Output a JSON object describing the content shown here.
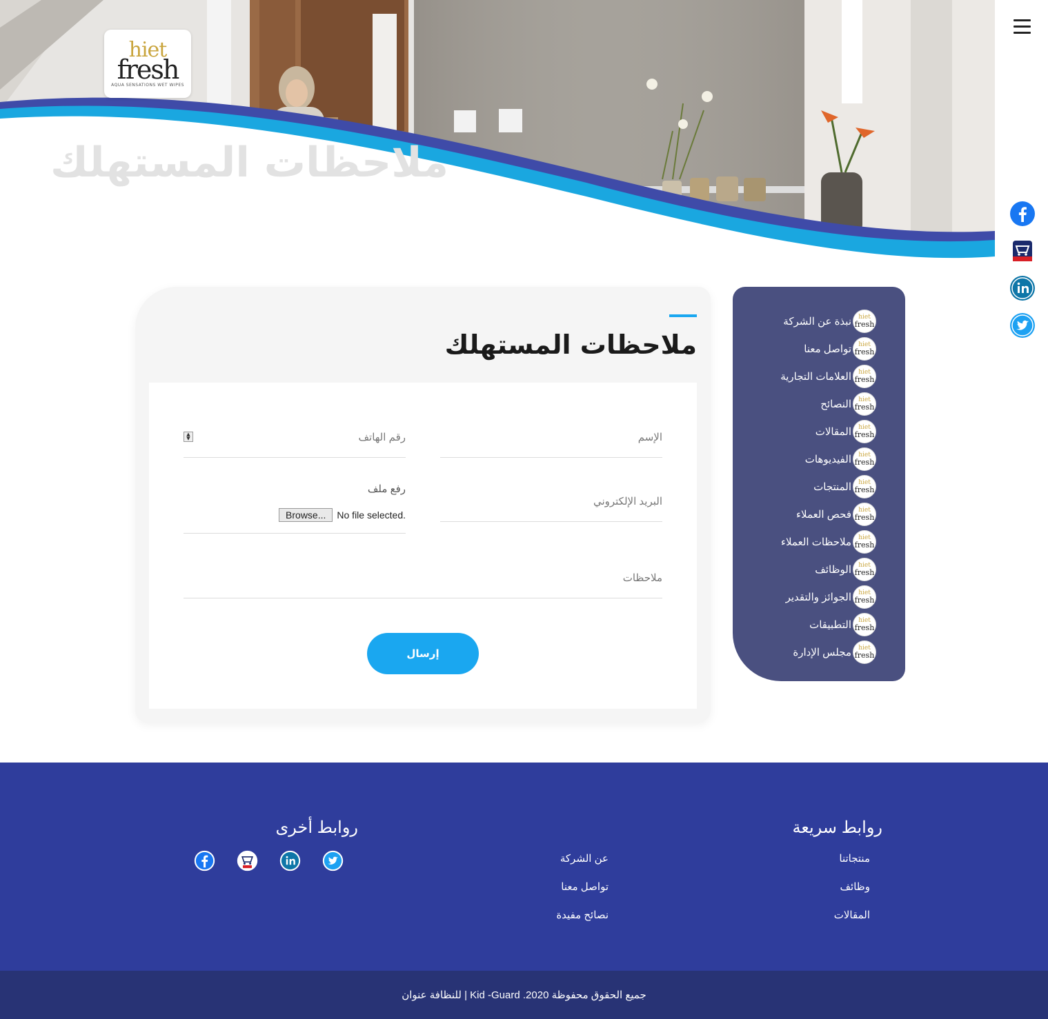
{
  "hero": {
    "title": "ملاحظات المستهلك",
    "logo": {
      "line1": "hiet",
      "line2": "fresh",
      "tagline": "AQUA SENSATIONS WET WIPES"
    }
  },
  "header": {
    "menu_icon": "hamburger-icon"
  },
  "side_social": [
    {
      "name": "facebook-icon",
      "color": "#1877f2"
    },
    {
      "name": "thelist-icon",
      "color": "#d81f26"
    },
    {
      "name": "linkedin-icon",
      "color": "#0e76a8"
    },
    {
      "name": "twitter-icon",
      "color": "#1da1f2"
    }
  ],
  "form": {
    "heading": "ملاحظات المستهلك",
    "name_placeholder": "الإسم",
    "phone_placeholder": "رقم الهاتف",
    "email_placeholder": "البريد الإلكتروني",
    "file_label": "رفع ملف",
    "file_button": "Browse...",
    "file_status": "No file selected.",
    "notes_placeholder": "ملاحظات",
    "submit_label": "إرسال"
  },
  "sidebar": {
    "items": [
      {
        "label": "نبذة عن الشركة"
      },
      {
        "label": "تواصل معنا"
      },
      {
        "label": "العلامات التجارية"
      },
      {
        "label": "النصائح"
      },
      {
        "label": "المقالات"
      },
      {
        "label": "الفيديوهات"
      },
      {
        "label": "المنتجات"
      },
      {
        "label": "فحص العملاء"
      },
      {
        "label": "ملاحظات العملاء"
      },
      {
        "label": "الوظائف"
      },
      {
        "label": "الجوائز والتقدير"
      },
      {
        "label": "التطبيقات"
      },
      {
        "label": "مجلس الإدارة"
      }
    ],
    "mini_logo": {
      "line1": "hiet",
      "line2": "fresh"
    }
  },
  "footer": {
    "quick_links_title": "روابط سريعة",
    "quick_links_col1": [
      "منتجاتنا",
      "وظائف",
      "المقالات"
    ],
    "quick_links_col2": [
      "عن الشركة",
      "تواصل معنا",
      "نصائح مفيدة"
    ],
    "other_links_title": "روابط أخرى",
    "copyright": "جميع الحقوق محفوظة 2020. Kid -Guard | للنظافة عنوان"
  },
  "colors": {
    "accent": "#1aa7f0",
    "sidebar": "#4a5080",
    "footer": "#2f3d9c",
    "copyright_bar": "#283375"
  }
}
